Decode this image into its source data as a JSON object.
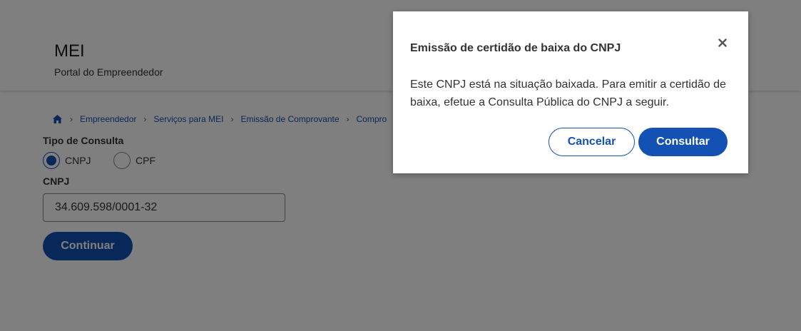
{
  "header": {
    "title": "MEI",
    "subtitle": "Portal do Empreendedor"
  },
  "breadcrumb": {
    "home_icon": "home-icon",
    "items": [
      "Empreendedor",
      "Serviços para MEI",
      "Emissão de Comprovante",
      "Compro"
    ]
  },
  "form": {
    "tipo_label": "Tipo de Consulta",
    "options": [
      {
        "label": "CNPJ",
        "checked": true
      },
      {
        "label": "CPF",
        "checked": false
      }
    ],
    "cnpj_label": "CNPJ",
    "cnpj_value": "34.609.598/0001-32",
    "continue_label": "Continuar"
  },
  "modal": {
    "title": "Emissão de certidão de baixa do CNPJ",
    "close_icon": "close-icon",
    "message": "Este CNPJ está na situação baixada. Para emitir a certidão de baixa, efetue a Consulta Pública do CNPJ a seguir.",
    "cancel_label": "Cancelar",
    "confirm_label": "Consultar"
  },
  "colors": {
    "primary": "#1351b4",
    "overlay": "rgba(0,0,0,0.5)"
  }
}
